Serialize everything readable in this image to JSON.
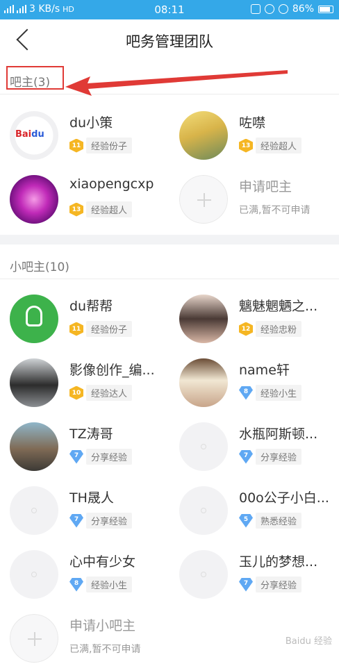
{
  "status_bar": {
    "network": "3 KB/s",
    "hd": "HD",
    "time": "08:11",
    "battery": "86%"
  },
  "header": {
    "title": "吧务管理团队"
  },
  "owners": {
    "title": "吧主(3)",
    "members": [
      {
        "name": "du小策",
        "level": "11",
        "level_type": "gold",
        "rank": "经验份子",
        "avatar": "baidu-logo-avatar"
      },
      {
        "name": "咗噤",
        "level": "13",
        "level_type": "gold",
        "rank": "经验超人",
        "avatar": "anime-avatar"
      },
      {
        "name": "xiaopengcxp",
        "level": "13",
        "level_type": "gold",
        "rank": "经验超人",
        "avatar": "purple-flower-avatar"
      }
    ],
    "apply": {
      "label": "申请吧主",
      "note": "已满,暂不可申请"
    }
  },
  "assistants": {
    "title": "小吧主(10)",
    "members": [
      {
        "name": "du帮帮",
        "level": "11",
        "level_type": "gold",
        "rank": "经验份子",
        "avatar": "lightbulb-avatar"
      },
      {
        "name": "魑魅魍魉之...",
        "level": "12",
        "level_type": "gold",
        "rank": "经验忠粉",
        "avatar": "girl-avatar"
      },
      {
        "name": "影像创作_编...",
        "level": "10",
        "level_type": "gold",
        "rank": "经验达人",
        "avatar": "man-avatar"
      },
      {
        "name": "name轩",
        "level": "8",
        "level_type": "blue",
        "rank": "经验小生",
        "avatar": "flower-girl-avatar"
      },
      {
        "name": "TZ涛哥",
        "level": "7",
        "level_type": "blue",
        "rank": "分享经验",
        "avatar": "street-avatar"
      },
      {
        "name": "水瓶阿斯顿...",
        "level": "7",
        "level_type": "blue",
        "rank": "分享经验",
        "avatar": "default-avatar"
      },
      {
        "name": "TH晟人",
        "level": "7",
        "level_type": "blue",
        "rank": "分享经验",
        "avatar": "default-avatar"
      },
      {
        "name": "00o公子小白...",
        "level": "5",
        "level_type": "blue",
        "rank": "熟悉经验",
        "avatar": "default-avatar"
      },
      {
        "name": "心中有少女",
        "level": "8",
        "level_type": "blue",
        "rank": "经验小生",
        "avatar": "default-avatar"
      },
      {
        "name": "玉儿的梦想...",
        "level": "7",
        "level_type": "blue",
        "rank": "分享经验",
        "avatar": "default-avatar"
      }
    ],
    "apply": {
      "label": "申请小吧主",
      "note": "已满,暂不可申请"
    }
  },
  "colors": {
    "status_bar": "#34a8e8",
    "annotation": "#e03a36",
    "gold_badge": "#f5b623",
    "blue_badge": "#5fa8f3"
  },
  "watermark": "Baidu 经验"
}
